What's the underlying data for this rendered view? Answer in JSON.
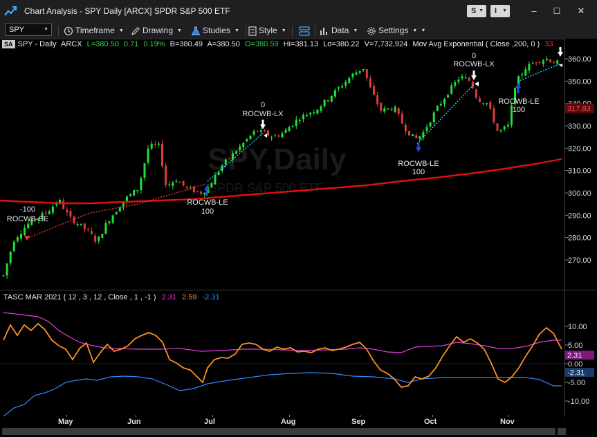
{
  "window": {
    "title": "Chart Analysis - SPY Daily [ARCX] SPDR S&P 500 ETF",
    "s_button": "S",
    "i_button": "I",
    "minimize": "–",
    "maximize": "☐",
    "close": "✕"
  },
  "toolbar": {
    "symbol": "SPY",
    "timeframe": "Timeframe",
    "drawing": "Drawing",
    "studies": "Studies",
    "style": "Style",
    "data": "Data",
    "settings": "Settings"
  },
  "info_bar": {
    "badge": "SA",
    "symbol": "SPY - Daily",
    "exchange": "ARCX",
    "last": "L=380.50",
    "change": "0.71",
    "change_pct": "0.19%",
    "bid": "B=380.49",
    "ask": "A=380.50",
    "open": "O=380.59",
    "high": "Hi=381.13",
    "low": "Lo=380.22",
    "volume": "V=7,732,924",
    "ma_label": "Mov Avg Exponential ( Close ,200, 0 )",
    "ma_value": "33"
  },
  "watermark": {
    "symbol": "SPY,Daily",
    "name": "SPDR S&P 500 ETF"
  },
  "price_axis": {
    "ticks": [
      "360.00",
      "350.00",
      "340.00",
      "330.00",
      "320.00",
      "310.00",
      "300.00",
      "290.00",
      "280.00",
      "270.00"
    ],
    "ma_flag": "317.83"
  },
  "signals": [
    {
      "label": "-100",
      "name": "ROCWB-SE"
    },
    {
      "label": "0",
      "name": "ROCWB-LX"
    },
    {
      "label": "100",
      "name": "ROCWB-LE"
    },
    {
      "label": "100",
      "name": "ROCWB-LE"
    },
    {
      "label": "0",
      "name": "ROCWB-LX"
    },
    {
      "label": "100",
      "name": "ROCWB-LE"
    }
  ],
  "indicator": {
    "title": "TASC MAR 2021 ( 12 , 3 , 12 , Close , 1 , -1 )",
    "v1": "2.31",
    "v2": "2.59",
    "v3": "-2.31",
    "ticks": [
      "10.00",
      "5.00",
      "0.00",
      "-5.00",
      "-10.00"
    ],
    "flag_pos": "2.31",
    "flag_neg": "-2.31"
  },
  "x_axis": {
    "months": [
      "May",
      "Jun",
      "Jul",
      "Aug",
      "Sep",
      "Oct",
      "Nov"
    ]
  },
  "colors": {
    "up": "#22e03a",
    "down": "#e03a3a",
    "ma": "#e01010",
    "magenta": "#e040e0",
    "orange": "#ff9020",
    "blue": "#2f8cff",
    "cyan": "#20d0e8"
  }
}
